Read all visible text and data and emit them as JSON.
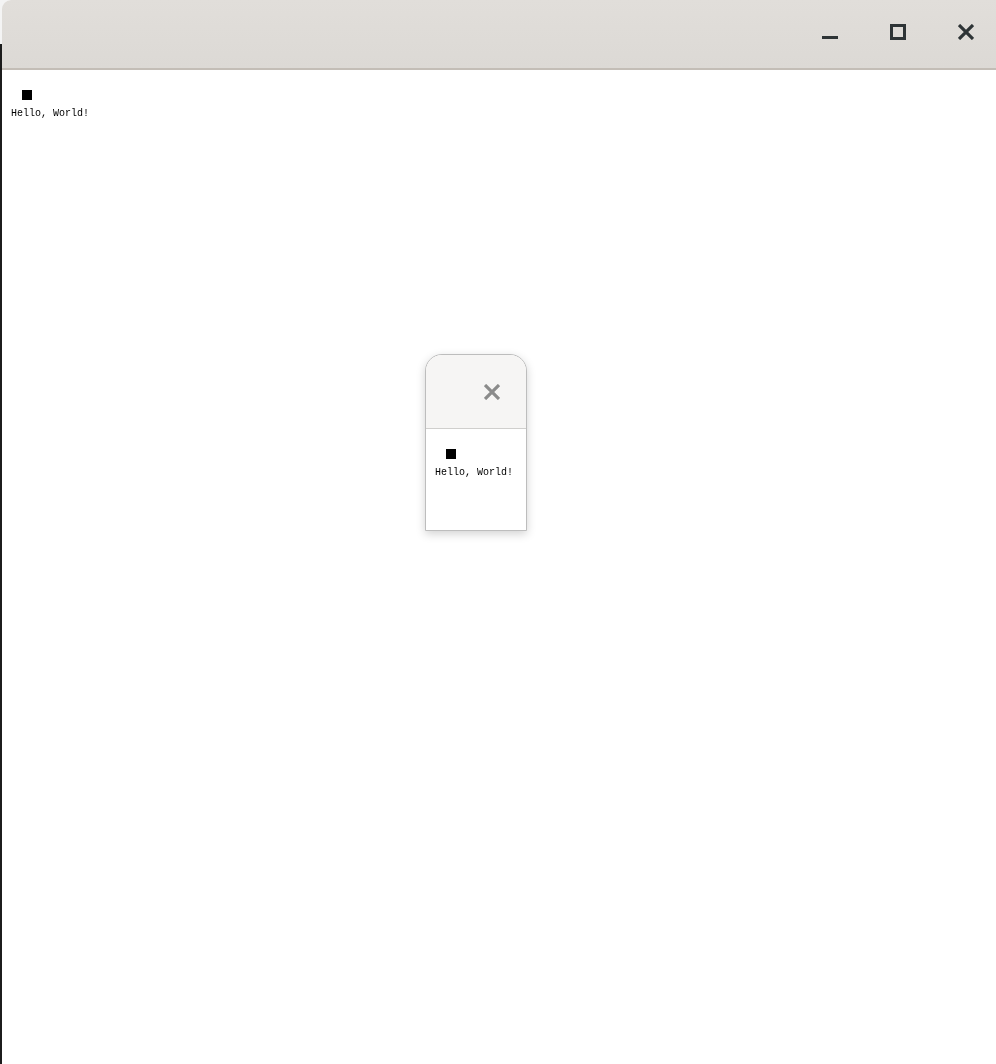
{
  "window": {
    "controls": [
      {
        "kind": "minimize"
      },
      {
        "kind": "maximize"
      },
      {
        "kind": "close"
      }
    ],
    "content": {
      "text": "Hello, World!"
    }
  },
  "dialog": {
    "controls": [
      {
        "kind": "close"
      }
    ],
    "content": {
      "text": "Hello, World!"
    }
  }
}
